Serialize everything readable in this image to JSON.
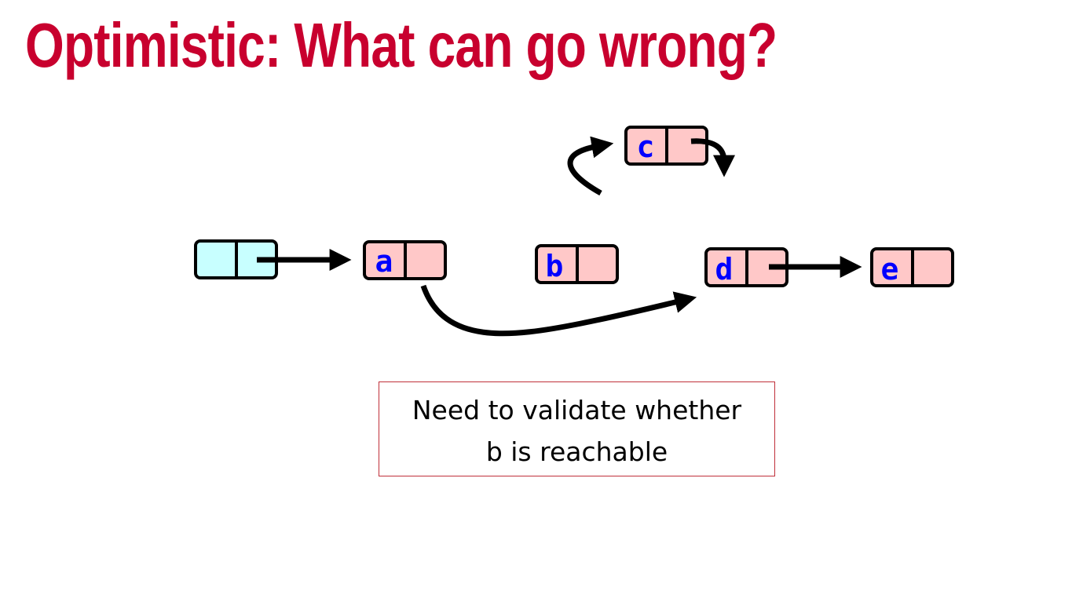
{
  "slide": {
    "title": "Optimistic: What can go wrong?"
  },
  "colors": {
    "title": "#c8002e",
    "node_fill": "#ffc8c8",
    "head_fill": "#c8ffff",
    "node_stroke": "#000000",
    "label_color": "#0000ff",
    "note_border": "#c0303a"
  },
  "nodes": {
    "head": {
      "label": ""
    },
    "a": {
      "label": "a"
    },
    "b": {
      "label": "b"
    },
    "c": {
      "label": "c"
    },
    "d": {
      "label": "d"
    },
    "e": {
      "label": "e"
    }
  },
  "note": {
    "line1": "Need to validate whether",
    "line2": "b is reachable"
  }
}
